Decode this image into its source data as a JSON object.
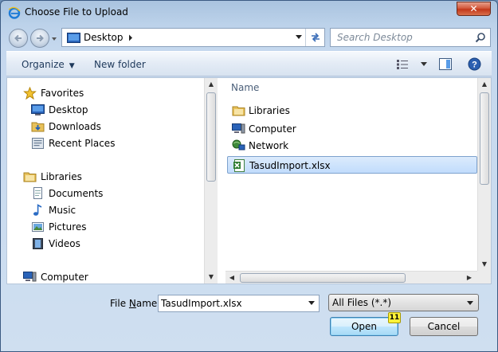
{
  "window": {
    "title": "Choose File to Upload",
    "close_label": "✕"
  },
  "address": {
    "location": "Desktop"
  },
  "search": {
    "placeholder": "Search Desktop"
  },
  "toolbar": {
    "organize_label": "Organize",
    "new_folder_label": "New folder"
  },
  "nav_pane": {
    "favorites": {
      "label": "Favorites",
      "items": [
        "Desktop",
        "Downloads",
        "Recent Places"
      ]
    },
    "libraries": {
      "label": "Libraries",
      "items": [
        "Documents",
        "Music",
        "Pictures",
        "Videos"
      ]
    },
    "computer": {
      "label": "Computer"
    }
  },
  "file_pane": {
    "column_name": "Name",
    "items": [
      {
        "name": "Libraries",
        "icon": "libraries-icon"
      },
      {
        "name": "Computer",
        "icon": "computer-icon"
      },
      {
        "name": "Network",
        "icon": "network-icon"
      },
      {
        "name": "TasudImport.xlsx",
        "icon": "excel-file-icon",
        "selected": true
      }
    ]
  },
  "bottom": {
    "file_name_label_u": "N",
    "file_name_label_pre": "File ",
    "file_name_label_post": "ame:",
    "file_name_value": "TasudImport.xlsx",
    "file_type": "All Files (*.*)",
    "open_label": "Open",
    "cancel_label": "Cancel",
    "badge": "11"
  },
  "colors": {
    "selection": "#c1dcfc",
    "badge": "#fff23a",
    "close": "#c2381a"
  }
}
